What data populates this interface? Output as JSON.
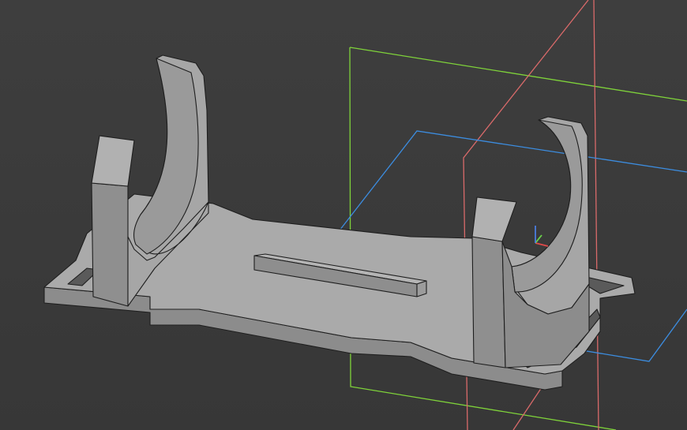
{
  "viewport": {
    "background": "#3b3b3b",
    "part_color": "#a9a9a9",
    "edge_color": "#1e1e1e",
    "plane_colors": {
      "xy": "#3c8de0",
      "xz": "#7fd33a",
      "yz": "#d96a6a"
    },
    "axis_colors": {
      "x": "#e04a4a",
      "y": "#6bd44a",
      "z": "#4a7de0"
    }
  }
}
